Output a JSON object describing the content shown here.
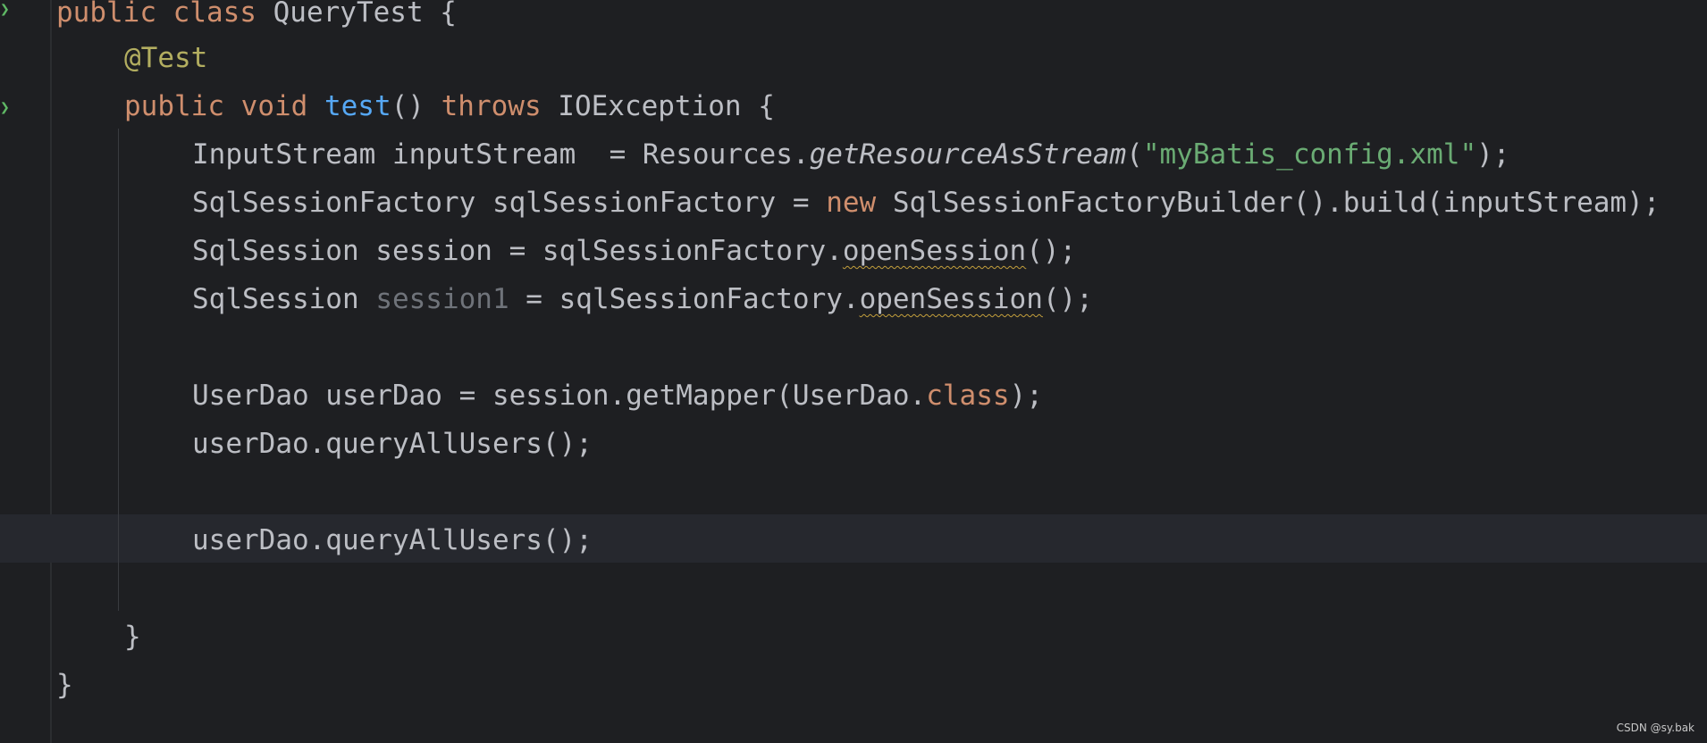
{
  "editor": {
    "lines": [
      {
        "id": "l1",
        "tokens": [
          "public",
          " ",
          "class",
          " QueryTest {"
        ]
      },
      {
        "id": "l2",
        "tokens": [
          "@Test"
        ]
      },
      {
        "id": "l3",
        "tokens": [
          "public",
          " ",
          "void",
          " ",
          "test",
          "() ",
          "throws",
          " IOException {"
        ]
      },
      {
        "id": "l4",
        "tokens": [
          "InputStream inputStream  = Resources.",
          "getResourceAsStream",
          "(",
          "\"myBatis_config.xml\"",
          ");"
        ]
      },
      {
        "id": "l5",
        "tokens": [
          "SqlSessionFactory sqlSessionFactory = ",
          "new",
          " SqlSessionFactoryBuilder().build(inputStream);"
        ]
      },
      {
        "id": "l6",
        "tokens": [
          "SqlSession session = sqlSessionFactory.",
          "openSession",
          "();"
        ]
      },
      {
        "id": "l7",
        "tokens": [
          "SqlSession ",
          "session1",
          " = sqlSessionFactory.",
          "openSession",
          "();"
        ]
      },
      {
        "id": "l8",
        "tokens": [
          "UserDao userDao = session.getMapper(UserDao.",
          "class",
          ");"
        ]
      },
      {
        "id": "l9",
        "tokens": [
          "userDao.queryAllUsers();"
        ]
      },
      {
        "id": "l10",
        "tokens": [
          "userDao.queryAllUsers();"
        ]
      },
      {
        "id": "l11",
        "tokens": [
          "}"
        ]
      },
      {
        "id": "l12",
        "tokens": [
          "}"
        ]
      }
    ],
    "gutter_icons": [
      "run-class-icon",
      "run-test-icon"
    ],
    "colors": {
      "background": "#1e1f22",
      "keyword": "#cf8e6d",
      "annotation": "#b3ae60",
      "method_declaration": "#56a8f5",
      "string": "#6aab73",
      "unused_variable": "#6f737a",
      "default_text": "#bcbec4"
    }
  },
  "watermark": "CSDN @sy.bak"
}
